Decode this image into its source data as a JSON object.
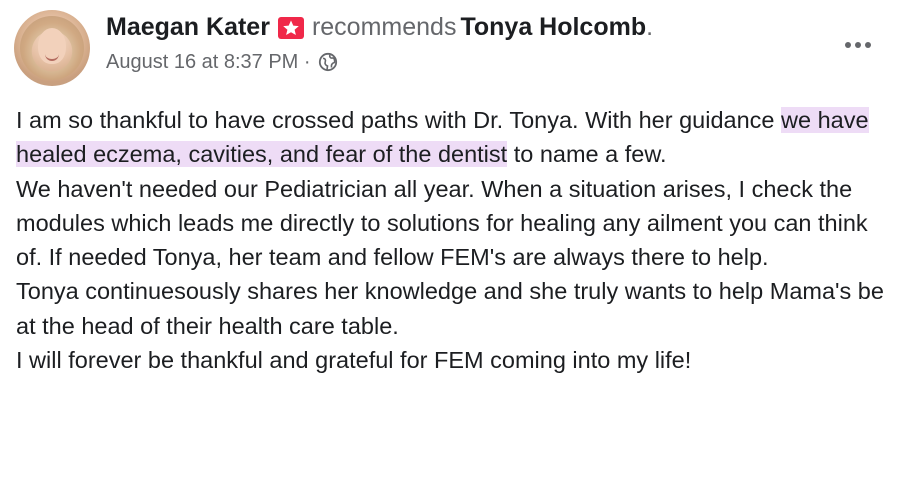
{
  "post": {
    "author": "Maegan Kater",
    "action": "recommends",
    "target": "Tonya Holcomb",
    "target_suffix": ".",
    "timestamp": "August 16 at 8:37 PM",
    "separator": "·",
    "privacy_icon": "globe-icon",
    "recommend_icon": "recommend-star-icon",
    "more_icon": "more-dots-icon"
  },
  "body": {
    "p1_before": "I am so thankful to have crossed paths with Dr. Tonya. With her guidance ",
    "p1_highlight": "we have healed eczema, cavities, and fear of the dentist",
    "p1_after": " to name a few.",
    "p2": "We haven't needed our Pediatrician all year. When a situation arises, I check the modules which leads me directly to solutions for healing any ailment you can think of. If needed Tonya, her team and fellow FEM's are always there to help.",
    "p3": "Tonya continuesously shares her knowledge and she truly wants to help Mama's be at the head of their health care table.",
    "p4": "I will forever be thankful and grateful for FEM coming into my life!"
  },
  "colors": {
    "highlight": "#eedcf6",
    "recommend_badge": "#f02849",
    "secondary_text": "#65676b",
    "primary_text": "#1c1e21"
  }
}
